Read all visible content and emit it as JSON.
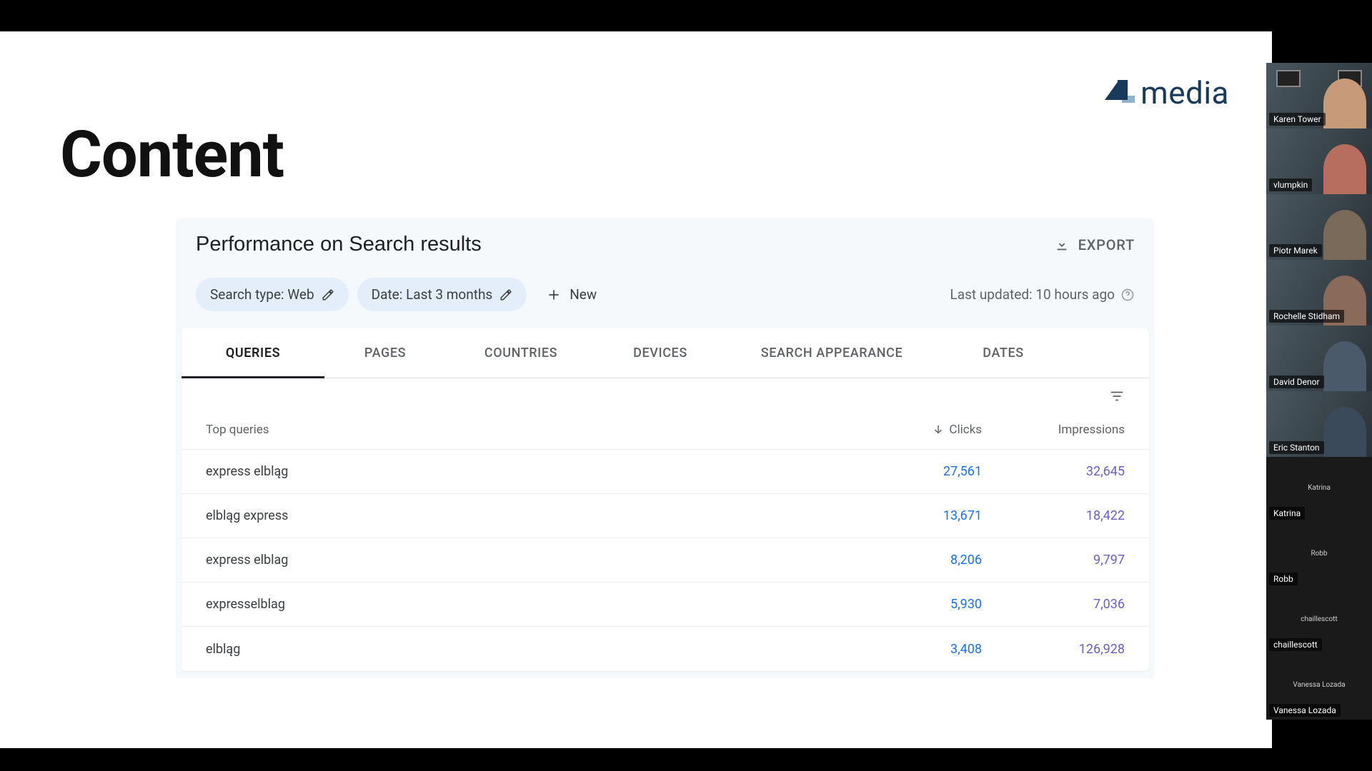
{
  "brand": {
    "text": "media"
  },
  "page": {
    "title": "Content"
  },
  "panel": {
    "title": "Performance on Search results",
    "export_label": "EXPORT",
    "chips": {
      "search_type": "Search type: Web",
      "date": "Date: Last 3 months"
    },
    "new_label": "New",
    "last_updated": "Last updated: 10 hours ago"
  },
  "tabs": [
    "QUERIES",
    "PAGES",
    "COUNTRIES",
    "DEVICES",
    "SEARCH APPEARANCE",
    "DATES"
  ],
  "table": {
    "header_query": "Top queries",
    "header_clicks": "Clicks",
    "header_impressions": "Impressions",
    "rows": [
      {
        "q": "express elbląg",
        "clicks": "27,561",
        "impressions": "32,645"
      },
      {
        "q": "elbląg express",
        "clicks": "13,671",
        "impressions": "18,422"
      },
      {
        "q": "express elblag",
        "clicks": "8,206",
        "impressions": "9,797"
      },
      {
        "q": "expresselblag",
        "clicks": "5,930",
        "impressions": "7,036"
      },
      {
        "q": "elbląg",
        "clicks": "3,408",
        "impressions": "126,928"
      }
    ]
  },
  "participants": [
    {
      "name": "Karen Tower",
      "video": true
    },
    {
      "name": "vlumpkin",
      "video": true
    },
    {
      "name": "Piotr Marek",
      "video": true
    },
    {
      "name": "Rochelle Stidham",
      "video": true
    },
    {
      "name": "David Denor",
      "video": true
    },
    {
      "name": "Eric Stanton",
      "video": true
    },
    {
      "name": "Katrina",
      "video": false,
      "avatar": "Katrina"
    },
    {
      "name": "Robb",
      "video": false,
      "avatar": "Robb"
    },
    {
      "name": "chaillescott",
      "video": false,
      "avatar": "chaillescott"
    },
    {
      "name": "Vanessa Lozada",
      "video": false,
      "avatar": "Vanessa Lozada"
    }
  ]
}
